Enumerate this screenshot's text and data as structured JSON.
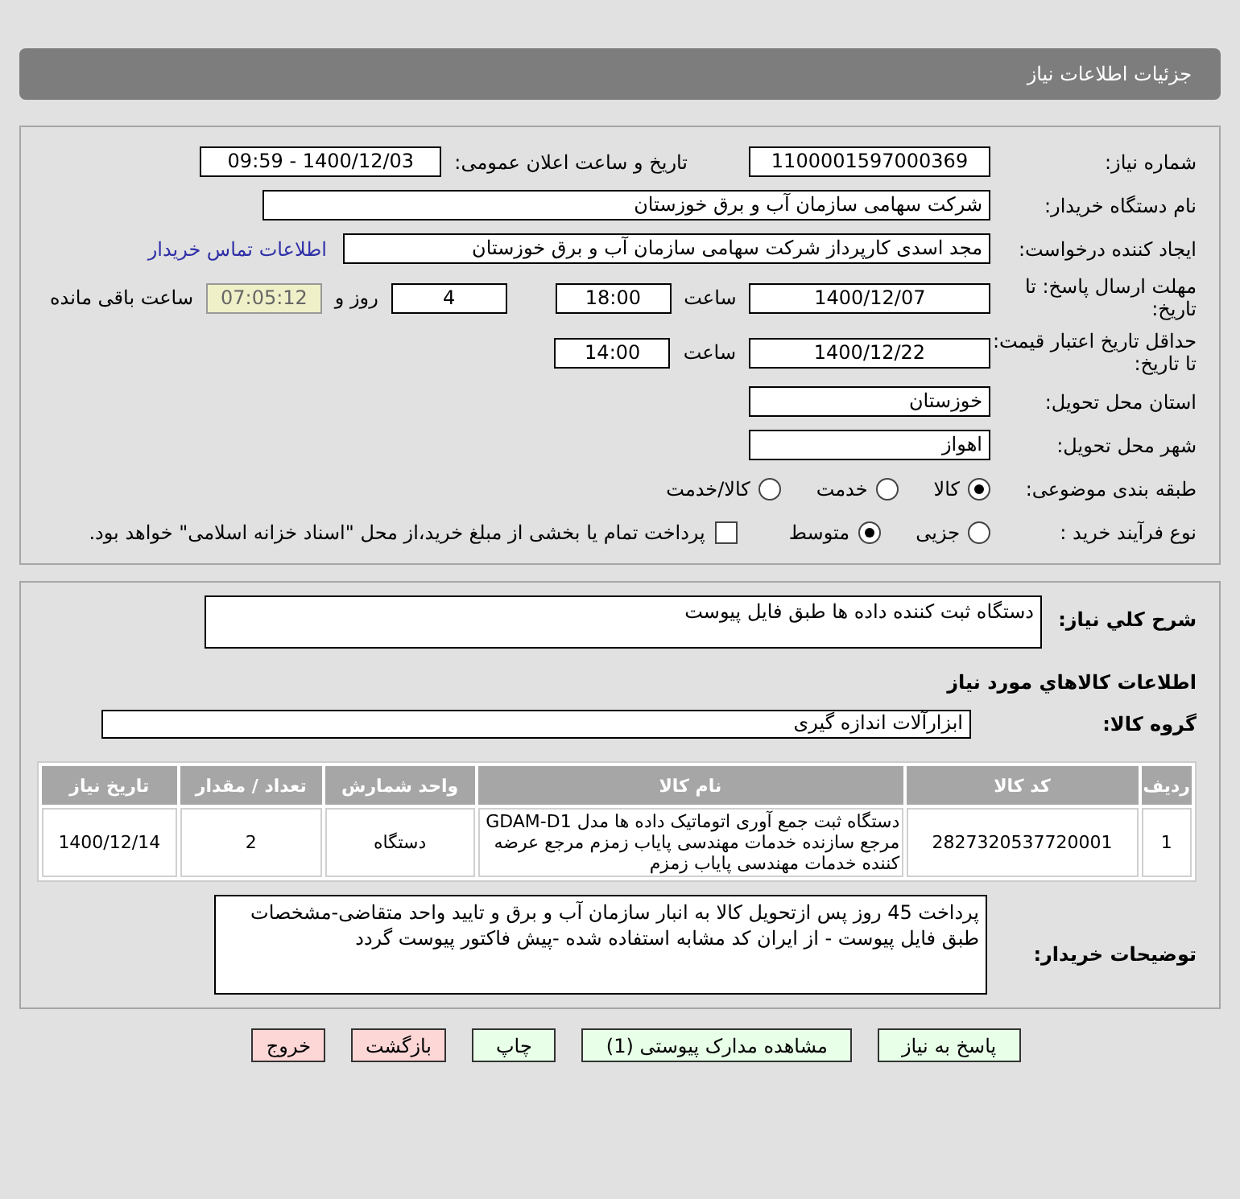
{
  "header": {
    "title": "جزئیات اطلاعات نیاز"
  },
  "details": {
    "need_number": {
      "label": "شماره نیاز:",
      "value": "1100001597000369"
    },
    "announce": {
      "label": "تاریخ و ساعت اعلان عمومی:",
      "value": "1400/12/03 - 09:59"
    },
    "buyer": {
      "label": "نام دستگاه خریدار:",
      "value": "شرکت سهامی سازمان آب و برق خوزستان"
    },
    "creator": {
      "label": "ایجاد کننده درخواست:",
      "value": "مجد اسدی کارپرداز شرکت سهامی سازمان آب و برق خوزستان",
      "link": "اطلاعات تماس خریدار"
    },
    "deadline": {
      "label": "مهلت ارسال پاسخ: تا تاریخ:",
      "date": "1400/12/07",
      "time_label": "ساعت",
      "time": "18:00",
      "days": "4",
      "days_label": "روز و",
      "remaining": "07:05:12",
      "remaining_label": "ساعت باقی مانده"
    },
    "validity": {
      "label": "حداقل تاریخ اعتبار قیمت: تا تاریخ:",
      "date": "1400/12/22",
      "time_label": "ساعت",
      "time": "14:00"
    },
    "province": {
      "label": "استان محل تحویل:",
      "value": "خوزستان"
    },
    "city": {
      "label": "شهر محل تحویل:",
      "value": "اهواز"
    },
    "category": {
      "label": "طبقه بندی موضوعی:",
      "options": [
        {
          "label": "کالا",
          "selected": true
        },
        {
          "label": "خدمت",
          "selected": false
        },
        {
          "label": "کالا/خدمت",
          "selected": false
        }
      ]
    },
    "process": {
      "label": "نوع فرآیند خرید :",
      "options": [
        {
          "label": "جزیی",
          "selected": false
        },
        {
          "label": "متوسط",
          "selected": true
        }
      ],
      "payment": {
        "label": "پرداخت تمام یا بخشی از مبلغ خرید،از محل \"اسناد خزانه اسلامی\" خواهد بود.",
        "checked": false
      }
    }
  },
  "needs": {
    "summary": {
      "label": "شرح کلي نياز:",
      "value": "دستگاه ثبت کننده داده ها طبق فایل پیوست"
    },
    "goods_heading": "اطلاعات کالاهاي مورد نياز",
    "group": {
      "label": "گروه کالا:",
      "value": "ابزارآلات اندازه گیری"
    },
    "table": {
      "columns": [
        "رديف",
        "کد کالا",
        "نام کالا",
        "واحد شمارش",
        "تعداد / مقدار",
        "تاریخ نیاز"
      ],
      "rows": [
        [
          "1",
          "2827320537720001",
          "دستگاه ثبت جمع آوری اتوماتیک داده ها مدل GDAM-D1 مرجع سازنده خدمات مهندسی پایاب زمزم مرجع عرضه کننده خدمات مهندسی پایاب زمزم",
          "دستگاه",
          "2",
          "1400/12/14"
        ]
      ]
    },
    "notes": {
      "label": "توضیحات خریدار:",
      "value": "پرداخت 45 روز پس ازتحویل کالا به انبار سازمان آب و برق و تایید واحد متقاضی-مشخصات طبق فایل پیوست - از ایران کد مشابه استفاده شده -پیش فاکتور پیوست گردد"
    }
  },
  "buttons": [
    {
      "label": "پاسخ به نیاز",
      "kind": "action"
    },
    {
      "label": "مشاهده مدارک پیوستی (1)",
      "kind": "action"
    },
    {
      "label": "چاپ",
      "kind": "action"
    },
    {
      "label": "بازگشت",
      "kind": "exit"
    },
    {
      "label": "خروج",
      "kind": "exit"
    }
  ]
}
